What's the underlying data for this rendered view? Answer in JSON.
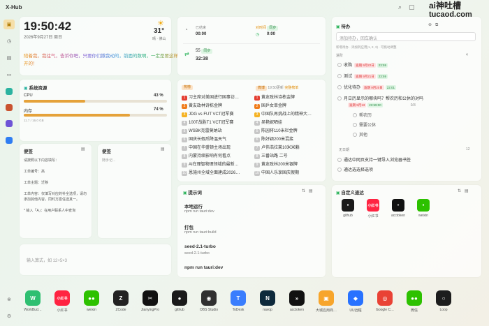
{
  "app": {
    "title": "X-Hub",
    "brand_line1": "ai神吐槽",
    "brand_line2": "tucaod.com"
  },
  "clock": {
    "time": "19:50:42",
    "date": "2026年9月27日 周日",
    "temp": "31°",
    "location": "晴 · 佛山",
    "quote": "陪着我，我往气，告诉你吧，只要你们撒我动的，前面的数啊，一定是要这样开的！"
  },
  "timers": [
    {
      "label": "已结束",
      "value": "00:00"
    },
    {
      "label": "对时间",
      "tag": "同步",
      "value": "0:00"
    },
    {
      "label": "55",
      "tag": "同步",
      "value": "32:38"
    }
  ],
  "sys": {
    "title": "系统资源",
    "cpu_label": "CPU",
    "cpu_value": "43 %",
    "cpu": 0.43,
    "mem_label": "内存",
    "mem_value": "74 %",
    "mem": 0.74,
    "mem_detail": "11.7 / 16.0 GB"
  },
  "notes": [
    {
      "title": "便签",
      "hint": "请按照以下内容填写：\n\n工单编号：高\n\n工单主题：迁移\n\n工单内容：仅填写对应的补全选项，请勿添加其他内容，同时方案任选其一。\n\n* 输入「A」：在用户联系人中查询"
    },
    {
      "title": "便签",
      "hint": "随手记..."
    }
  ],
  "calc": {
    "placeholder": "输入算式，如 12+5×3"
  },
  "hot": {
    "tab1": "热榜",
    "tab2": "微博",
    "time": "19:50更新",
    "tag": "完整榜单",
    "left": [
      "习主席对美国进行国事访…",
      "黄友政林诗栋金牌",
      "JDG vs FUT VCT冠军赛",
      "100T战胜T1 VCT冠军赛",
      "WSBK克雷莫纳站",
      "国庆长假后降温天气",
      "中国在华盛顿主场出现",
      "内蒙持续影响有何看点",
      "AI在理智物理领域的最新…",
      "恩施州全域全面建成2026…"
    ],
    "right": [
      "黄友政林诗栋金牌",
      "国乒女单金牌",
      "中国队再挑战上的精神大…",
      "吴艳妮晒娃",
      "陈园将110米栏金牌",
      "陈好颖200米混接",
      "卢伟浩拉莱10米米躺",
      "三番站路 二号",
      "黄友政林200米银牌",
      "中国人乐享国庆假期"
    ]
  },
  "todo": {
    "title": "待办",
    "placeholder": "添加待办，回车确认",
    "hint": "新增待办 · 添加到应用(1, 2, 3) · 可拖动调整",
    "section1": "进阶",
    "section1_count": "4",
    "items": [
      {
        "text": "收购",
        "red": "逾期 9月22日",
        "green": "23:59"
      },
      {
        "text": "测试",
        "red": "逾期 9月21日",
        "green": "23:59"
      },
      {
        "text": "优化待办",
        "red": "逾期 9月20日",
        "green": "22:01"
      },
      {
        "text": "月日历显示的哪块吗？帮农历和公休的对吗",
        "red": "逾期 9月13",
        "green": "23:59:00",
        "progress": "0/3"
      }
    ],
    "subitems": [
      "帮农历",
      "需要公休",
      "其他"
    ],
    "section2": "无日期",
    "section2_count": "12",
    "items2": [
      "通达中网页支持一键导入浏览器书签",
      "通达选选择选项"
    ]
  },
  "prompt": {
    "title": "提示词",
    "items": [
      {
        "title": "本地运行",
        "cmd": "npm run tauri:dev"
      },
      {
        "title": "打包",
        "cmd": "npm run tauri:build"
      },
      {
        "title": "seed-2.1-turbo",
        "cmd": "seed-2.1-turbo"
      },
      {
        "title": "npm run tauri:dev",
        "cmd": ""
      }
    ]
  },
  "custom": {
    "title": "自定义速达",
    "items": [
      {
        "label": "github",
        "color": "#1a1a1a",
        "glyph": "●"
      },
      {
        "label": "小红书",
        "color": "#ff2442",
        "glyph": "小红书"
      },
      {
        "label": "acctoken",
        "color": "#111111",
        "glyph": "»"
      },
      {
        "label": "weixin",
        "color": "#2dc100",
        "glyph": "●"
      }
    ]
  },
  "dock": [
    {
      "label": "WorkBud…",
      "color": "#2fbf71",
      "glyph": "W"
    },
    {
      "label": "小红书",
      "color": "#ff2442",
      "glyph": "小红书"
    },
    {
      "label": "weixin",
      "color": "#2dc100",
      "glyph": "●●"
    },
    {
      "label": "ZCode",
      "color": "#222222",
      "glyph": "Z"
    },
    {
      "label": "JianyingPro",
      "color": "#111111",
      "glyph": "✂"
    },
    {
      "label": "github",
      "color": "#1a1a1a",
      "glyph": "●"
    },
    {
      "label": "OBS Studio",
      "color": "#303030",
      "glyph": "◉"
    },
    {
      "label": "ToDesk",
      "color": "#3a7dfd",
      "glyph": "T"
    },
    {
      "label": "navop",
      "color": "#0e2a3c",
      "glyph": "N"
    },
    {
      "label": "acctoken",
      "color": "#111111",
      "glyph": "»"
    },
    {
      "label": "大城应用商…",
      "color": "#f7a52b",
      "glyph": "▣"
    },
    {
      "label": "UU远程",
      "color": "#2872ff",
      "glyph": "◆"
    },
    {
      "label": "Google C…",
      "color": "#e94235",
      "glyph": "◎"
    },
    {
      "label": "微信",
      "color": "#2dc100",
      "glyph": "●●"
    },
    {
      "label": "Loop",
      "color": "#1d1d1d",
      "glyph": "○"
    }
  ]
}
